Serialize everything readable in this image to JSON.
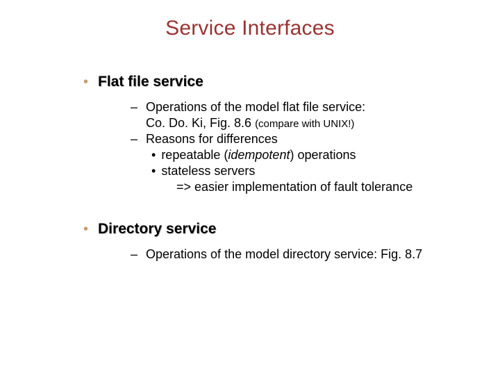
{
  "title": "Service Interfaces",
  "sections": [
    {
      "heading": "Flat file service",
      "items": [
        {
          "text": "Operations of the model flat file service:",
          "cont": "Co. Do. Ki, Fig. 8.6 ",
          "cont_small": "(compare with UNIX!)"
        },
        {
          "text": "Reasons for differences",
          "sub": [
            {
              "text_prefix": "repeatable (",
              "italic": "idempotent",
              "text_suffix": ") operations"
            },
            {
              "text_prefix": "stateless servers",
              "italic": "",
              "text_suffix": "",
              "line4": "=> easier implementation of fault tolerance"
            }
          ]
        }
      ]
    },
    {
      "heading": "Directory service",
      "items": [
        {
          "text": "Operations of the model directory service: Fig. 8.7"
        }
      ]
    }
  ],
  "bullets": {
    "l1": "•",
    "l2": "–",
    "l3": "•"
  }
}
